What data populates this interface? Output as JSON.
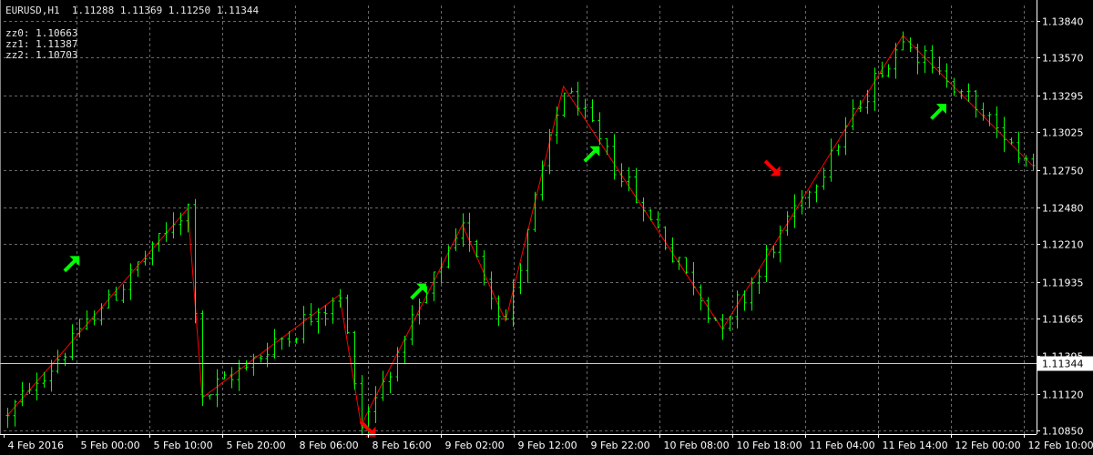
{
  "header": {
    "title": "EURUSD,H1  1.11288 1.11369 1.11250 1.11344",
    "zz": [
      "zz0: 1.10663",
      "zz1: 1.11387",
      "zz2: 1.10703"
    ]
  },
  "colors": {
    "background": "#000000",
    "grid": "#c0c0c0",
    "candles": "#00ff00",
    "zigzag": "#ff0000",
    "arrow_buy": "#00ff00",
    "arrow_sell": "#ff0000",
    "text": "#ffffff"
  },
  "chart_data": {
    "type": "ohlc",
    "symbol": "EURUSD",
    "timeframe": "H1",
    "ylim": [
      1.10825,
      1.1395
    ],
    "y_ticks": [
      1.1384,
      1.1357,
      1.13295,
      1.13025,
      1.1275,
      1.1248,
      1.1221,
      1.11935,
      1.11665,
      1.11395,
      1.1112,
      1.1085
    ],
    "x_ticks": [
      "4 Feb 2016",
      "5 Feb 00:00",
      "5 Feb 10:00",
      "5 Feb 20:00",
      "8 Feb 06:00",
      "8 Feb 16:00",
      "9 Feb 02:00",
      "9 Feb 12:00",
      "9 Feb 22:00",
      "10 Feb 08:00",
      "10 Feb 18:00",
      "11 Feb 04:00",
      "11 Feb 14:00",
      "12 Feb 00:00",
      "12 Feb 10:00"
    ],
    "current_price": "1.11344",
    "zigzag": [
      {
        "bar": 0,
        "price": 1.1096
      },
      {
        "bar": 25,
        "price": 1.1247
      },
      {
        "bar": 27,
        "price": 1.1109
      },
      {
        "bar": 46,
        "price": 1.1184
      },
      {
        "bar": 49,
        "price": 1.1089
      },
      {
        "bar": 63,
        "price": 1.1235
      },
      {
        "bar": 69,
        "price": 1.1165
      },
      {
        "bar": 77,
        "price": 1.1336
      },
      {
        "bar": 99,
        "price": 1.1159
      },
      {
        "bar": 124,
        "price": 1.1373
      },
      {
        "bar": 142,
        "price": 1.1278
      }
    ],
    "signals": [
      {
        "bar": 9,
        "direction": "buy",
        "price": 1.1207
      },
      {
        "bar": 57,
        "direction": "buy",
        "price": 1.1187
      },
      {
        "bar": 81,
        "direction": "buy",
        "price": 1.1287
      },
      {
        "bar": 106,
        "direction": "sell",
        "price": 1.1276
      },
      {
        "bar": 129,
        "direction": "buy",
        "price": 1.1318
      },
      {
        "bar": 50,
        "direction": "sell",
        "price": 1.1086
      }
    ]
  }
}
